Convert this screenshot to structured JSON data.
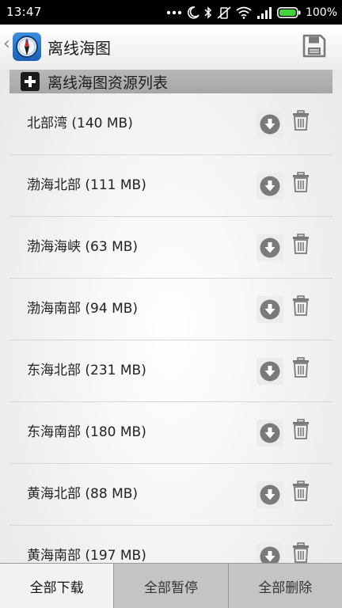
{
  "status_bar": {
    "time": "13:47",
    "battery_percent": "100%",
    "icons": [
      "more-dots-icon",
      "moon-icon",
      "bluetooth-icon",
      "vibrate-off-icon",
      "wifi-icon",
      "signal-icon",
      "battery-icon"
    ]
  },
  "app_bar": {
    "title": "离线海图",
    "back_glyph": "‹",
    "icons": [
      "compass-app-icon",
      "save-icon"
    ]
  },
  "section": {
    "title": "离线海图资源列表",
    "icon": "plus-icon"
  },
  "charts": [
    {
      "name": "北部湾 (140 MB)"
    },
    {
      "name": "渤海北部 (111 MB)"
    },
    {
      "name": "渤海海峡 (63 MB)"
    },
    {
      "name": "渤海南部 (94 MB)"
    },
    {
      "name": "东海北部 (231 MB)"
    },
    {
      "name": "东海南部 (180 MB)"
    },
    {
      "name": "黄海北部 (88 MB)"
    },
    {
      "name": "黄海南部 (197 MB)"
    }
  ],
  "row_icons": [
    "download-icon",
    "trash-icon"
  ],
  "bottom_bar": {
    "download_all": "全部下载",
    "pause_all": "全部暂停",
    "delete_all": "全部删除"
  },
  "colors": {
    "battery": "#3fd43a",
    "icon_gray": "#7a7a7a"
  }
}
